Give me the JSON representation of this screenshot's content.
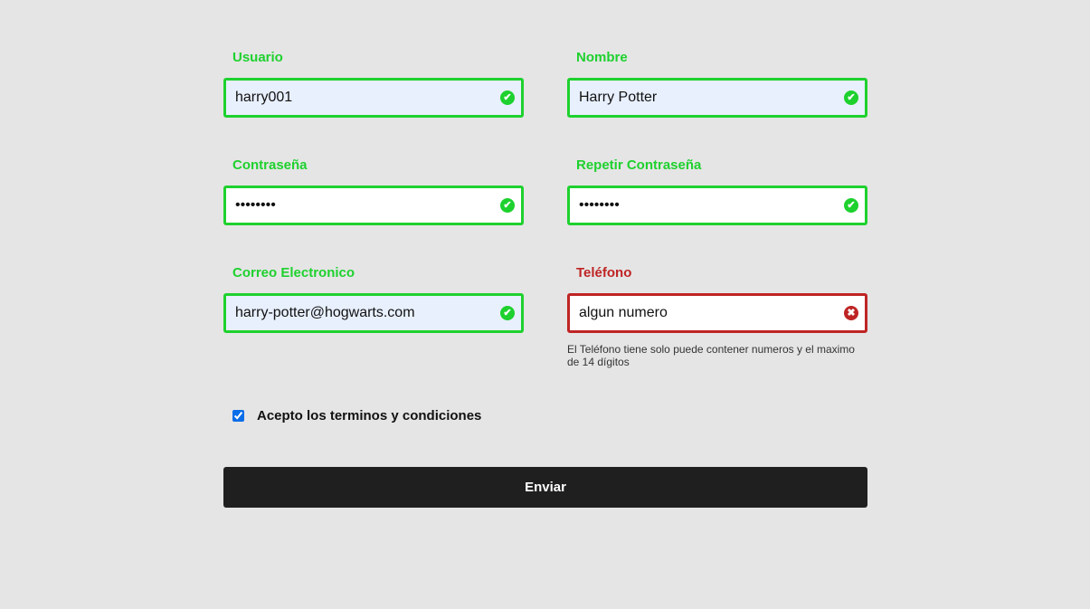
{
  "fields": {
    "usuario": {
      "label": "Usuario",
      "value": "harry001",
      "status": "valid"
    },
    "nombre": {
      "label": "Nombre",
      "value": "Harry Potter",
      "status": "valid"
    },
    "password": {
      "label": "Contraseña",
      "value": "********",
      "status": "valid"
    },
    "password2": {
      "label": "Repetir Contraseña",
      "value": "********",
      "status": "valid"
    },
    "correo": {
      "label": "Correo Electronico",
      "value": "harry-potter@hogwarts.com",
      "status": "valid"
    },
    "telefono": {
      "label": "Teléfono",
      "value": "algun numero",
      "status": "invalid",
      "error": "El Teléfono tiene solo puede contener numeros y el maximo de 14 dígitos"
    }
  },
  "icons": {
    "valid": "✔",
    "invalid": "✖"
  },
  "terms": {
    "label": "Acepto los terminos y condiciones",
    "checked": true
  },
  "submit_label": "Enviar",
  "colors": {
    "valid": "#1ed12e",
    "invalid": "#bf2424",
    "button": "#1f1f1f"
  }
}
